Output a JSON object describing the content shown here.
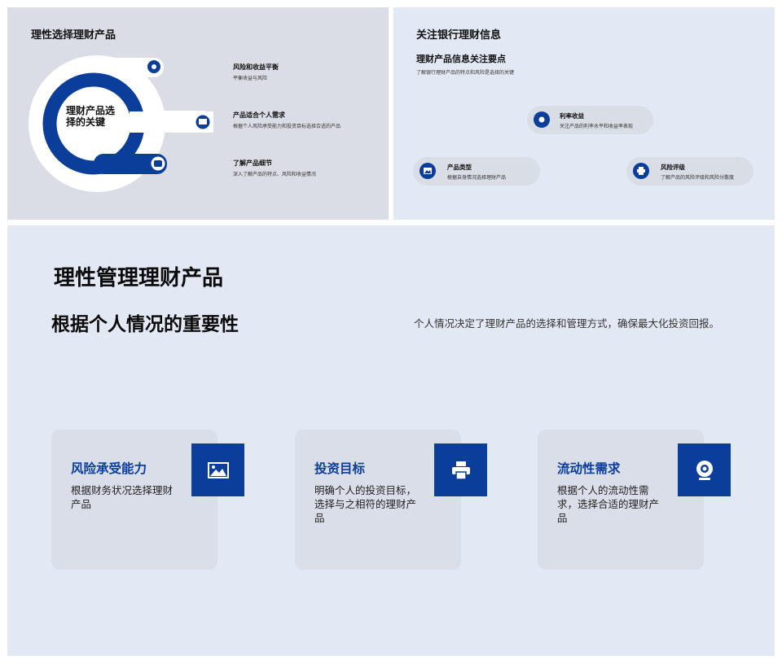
{
  "panel_a": {
    "title": "理性选择理财产品",
    "center_label": "理财产品选择的关键",
    "items": [
      {
        "title": "风险和收益平衡",
        "desc": "平衡收益与风险",
        "icon": "location-pin-icon"
      },
      {
        "title": "产品适合个人需求",
        "desc": "根据个人风险承受能力和投资目标选择合适的产品",
        "icon": "image-icon"
      },
      {
        "title": "了解产品细节",
        "desc": "深入了解产品的特点、风险和收益情况",
        "icon": "bus-icon"
      }
    ]
  },
  "panel_b": {
    "title": "关注银行理财信息",
    "subtitle": "理财产品信息关注要点",
    "desc": "了解银行理财产品的特点和风险是选择的关键",
    "pills": [
      {
        "title": "利率收益",
        "desc": "关注产品的利率水平和收益率表现",
        "icon": "location-pin-icon"
      },
      {
        "title": "产品类型",
        "desc": "根据自身情况选择理财产品",
        "icon": "image-icon"
      },
      {
        "title": "风险评级",
        "desc": "了解产品的风险评级和风险分散度",
        "icon": "printer-icon"
      }
    ]
  },
  "panel_c": {
    "title": "理性管理理财产品",
    "subtitle": "根据个人情况的重要性",
    "desc": "个人情况决定了理财产品的选择和管理方式，确保最大化投资回报。",
    "cards": [
      {
        "title": "风险承受能力",
        "body": "根据财务状况选择理财产品",
        "icon": "image-icon"
      },
      {
        "title": "投资目标",
        "body": "明确个人的投资目标，选择与之相符的理财产品",
        "icon": "printer-icon"
      },
      {
        "title": "流动性需求",
        "body": "根据个人的流动性需求，选择合适的理财产品",
        "icon": "webcam-icon"
      }
    ]
  },
  "colors": {
    "accent": "#0b3d9a",
    "panel_gray": "#dadde6",
    "panel_blue": "#e3e9f4",
    "card": "#d9dee8"
  }
}
